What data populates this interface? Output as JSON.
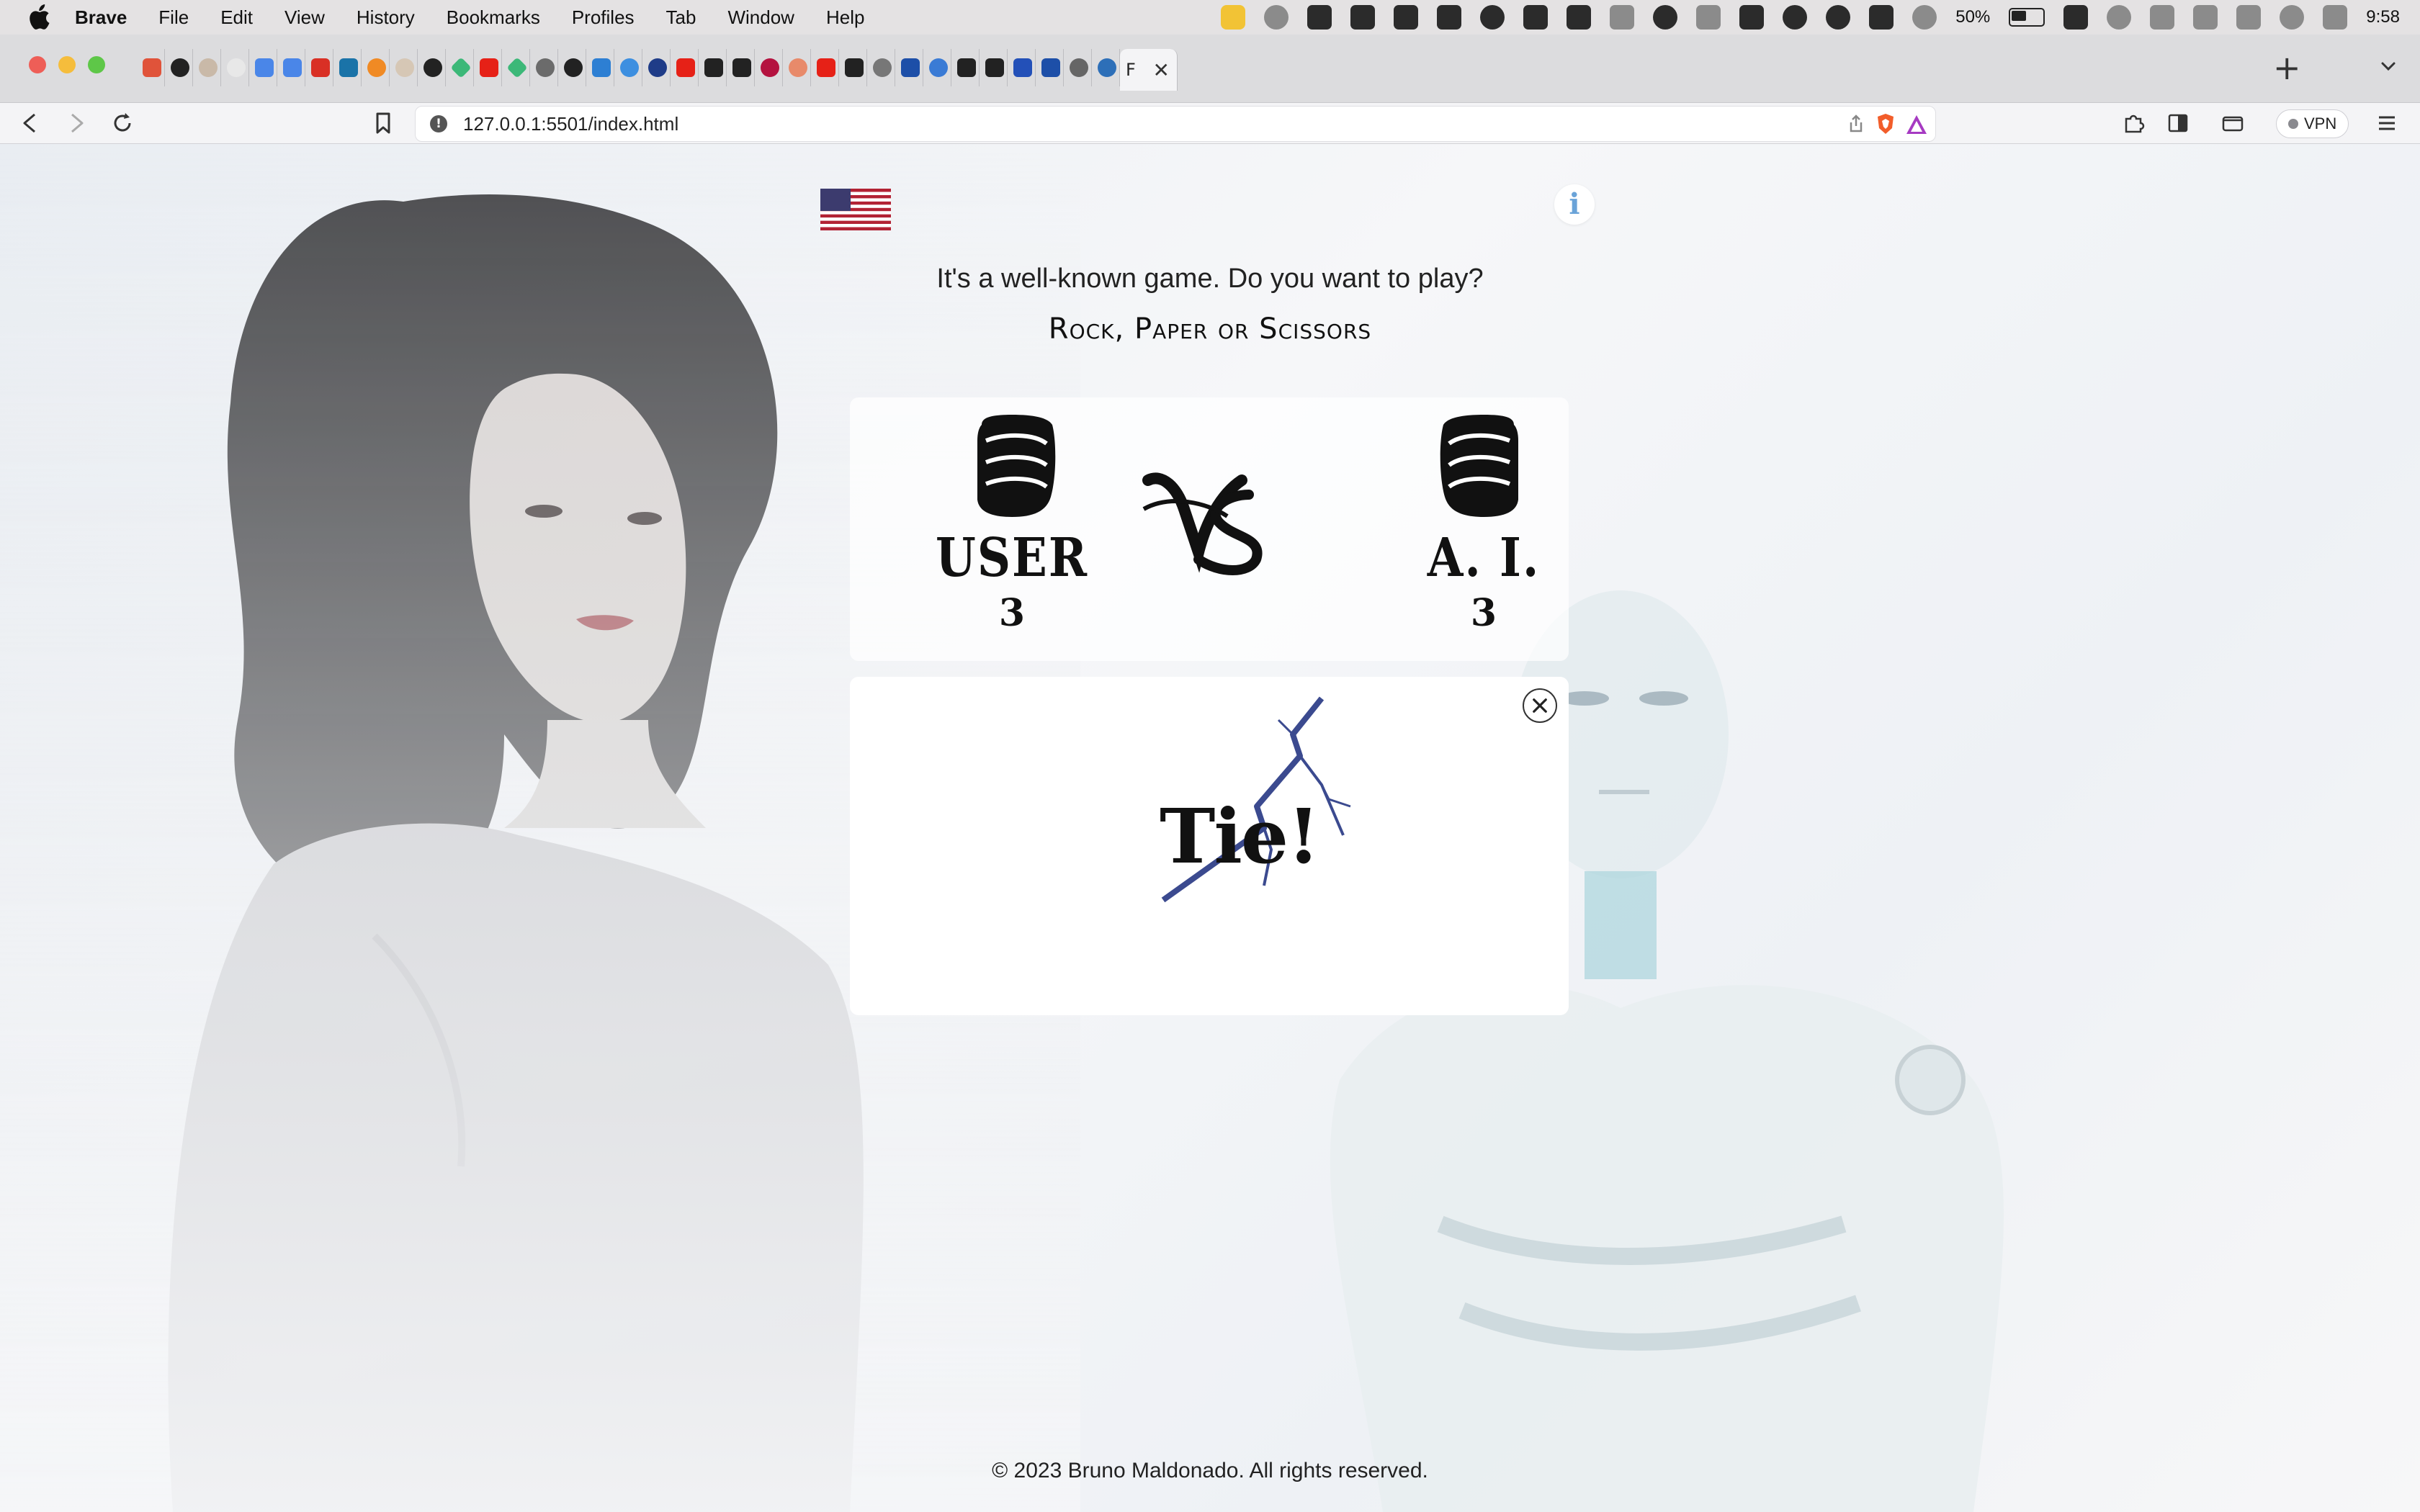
{
  "menubar": {
    "app_name": "Brave",
    "items": [
      "File",
      "Edit",
      "View",
      "History",
      "Bookmarks",
      "Profiles",
      "Tab",
      "Window",
      "Help"
    ],
    "battery_percent": "50%",
    "clock": "9:58"
  },
  "browser": {
    "url": "127.0.0.1:5501/index.html",
    "vpn_label": "VPN",
    "active_tab_label": "F",
    "new_tab_label": "+"
  },
  "page": {
    "subtitle": "It's a well-known game. Do you want to play?",
    "title": "Rock, Paper or Scissors",
    "user_label": "USER",
    "user_score": "3",
    "ai_label": "A. I.",
    "ai_score": "3",
    "result_text": "Tie!",
    "info_label": "i",
    "footer": "© 2023 Bruno Maldonado. All rights reserved."
  },
  "colors": {
    "accent_info": "#6aa3d8",
    "lightning": "#3b4a8f"
  }
}
